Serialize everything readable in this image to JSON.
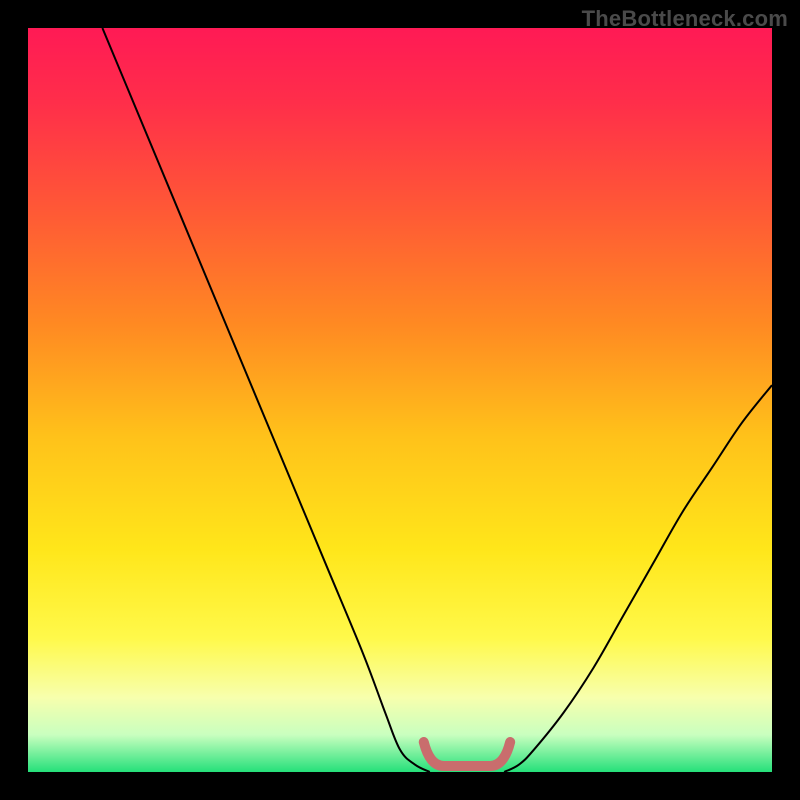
{
  "watermark": "TheBottleneck.com",
  "colors": {
    "frame_bg": "#000000",
    "watermark": "#4a4a4a",
    "curve": "#000000",
    "marker": "#c96d6d",
    "gradient_stops": [
      {
        "offset": 0.0,
        "color": "#ff1a55"
      },
      {
        "offset": 0.1,
        "color": "#ff2e4a"
      },
      {
        "offset": 0.25,
        "color": "#ff5a35"
      },
      {
        "offset": 0.4,
        "color": "#ff8a22"
      },
      {
        "offset": 0.55,
        "color": "#ffc21a"
      },
      {
        "offset": 0.7,
        "color": "#ffe61a"
      },
      {
        "offset": 0.82,
        "color": "#fff94a"
      },
      {
        "offset": 0.9,
        "color": "#f7ffad"
      },
      {
        "offset": 0.95,
        "color": "#c9ffbf"
      },
      {
        "offset": 1.0,
        "color": "#25e07a"
      }
    ]
  },
  "chart_data": {
    "type": "line",
    "title": "",
    "xlabel": "",
    "ylabel": "",
    "xlim": [
      0,
      100
    ],
    "ylim": [
      0,
      100
    ],
    "series": [
      {
        "name": "left-branch",
        "x": [
          10,
          15,
          20,
          25,
          30,
          35,
          40,
          45,
          48,
          50,
          52,
          54
        ],
        "values": [
          100,
          88,
          76,
          64,
          52,
          40,
          28,
          16,
          8,
          3,
          1,
          0
        ]
      },
      {
        "name": "right-branch",
        "x": [
          64,
          66,
          68,
          72,
          76,
          80,
          84,
          88,
          92,
          96,
          100
        ],
        "values": [
          0,
          1,
          3,
          8,
          14,
          21,
          28,
          35,
          41,
          47,
          52
        ]
      }
    ],
    "optimal_region": {
      "name": "bottleneck-minimum-marker",
      "x_start": 54,
      "x_end": 64,
      "y": 0
    },
    "annotations": [
      {
        "text": "TheBottleneck.com",
        "role": "watermark"
      }
    ]
  }
}
